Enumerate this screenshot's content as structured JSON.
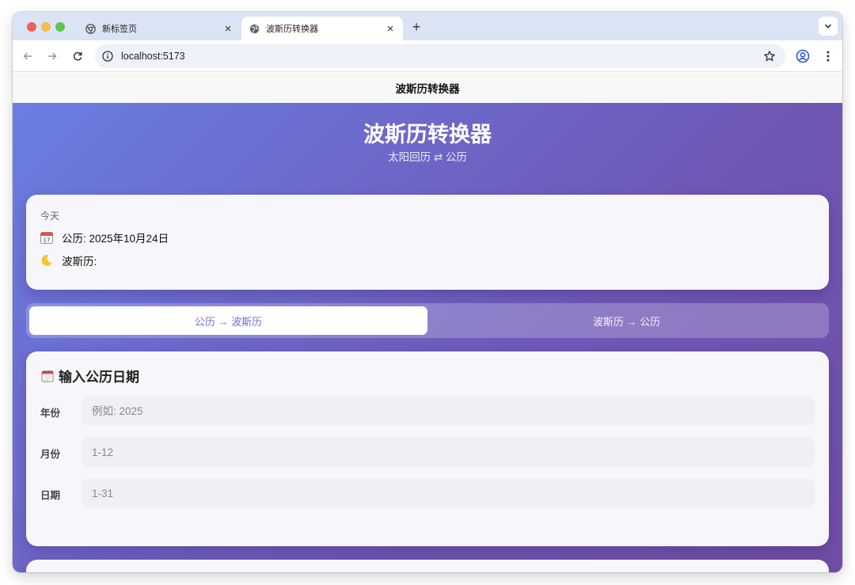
{
  "browser": {
    "tabs": [
      {
        "title": "新标签页",
        "active": false
      },
      {
        "title": "波斯历转换器",
        "active": true
      }
    ],
    "url": "localhost:5173",
    "close_glyph": "×",
    "new_tab_glyph": "+"
  },
  "page": {
    "header_title": "波斯历转换器",
    "hero_title": "波斯历转换器",
    "hero_subtitle": "太阳回历 ⇄ 公历",
    "today": {
      "label": "今天",
      "gregorian": "公历: 2025年10月24日",
      "persian": "波斯历:"
    },
    "mode_toggle": {
      "option_a": "公历 → 波斯历",
      "option_b": "波斯历 → 公历",
      "selected": "option_a"
    },
    "input_card": {
      "title": "输入公历日期",
      "fields": [
        {
          "label": "年份",
          "placeholder": "例如: 2025",
          "value": ""
        },
        {
          "label": "月份",
          "placeholder": "1-12",
          "value": ""
        },
        {
          "label": "日期",
          "placeholder": "1-31",
          "value": ""
        }
      ]
    }
  },
  "colors": {
    "gradient_start": "#6a7fe4",
    "gradient_end": "#714ea5",
    "accent": "#6a73d9",
    "card_bg": "#f7f7fb"
  },
  "icons": {
    "tab_favicon_1": "chrome-icon",
    "tab_favicon_2": "globe-icon",
    "today_gregorian": "calendar-icon",
    "today_persian": "crescent-moon-icon",
    "input_title": "spiral-calendar-icon"
  }
}
